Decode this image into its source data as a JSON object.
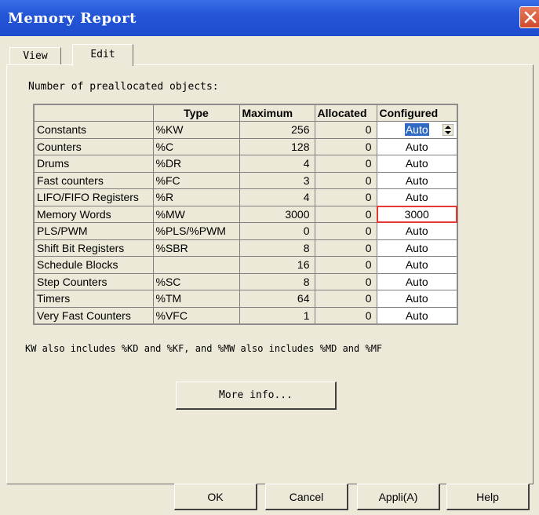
{
  "window": {
    "title": "Memory Report"
  },
  "tabs": [
    {
      "label": "View"
    },
    {
      "label": "Edit"
    }
  ],
  "section_label": "Number of preallocated objects:",
  "table": {
    "headers": [
      "",
      "Type",
      "Maximum",
      "Allocated",
      "Configured"
    ],
    "rows": [
      {
        "name": "Constants",
        "type": "%KW",
        "maximum": "256",
        "allocated": "0",
        "configured": "Auto"
      },
      {
        "name": "Counters",
        "type": "%C",
        "maximum": "128",
        "allocated": "0",
        "configured": "Auto"
      },
      {
        "name": "Drums",
        "type": "%DR",
        "maximum": "4",
        "allocated": "0",
        "configured": "Auto"
      },
      {
        "name": "Fast counters",
        "type": "%FC",
        "maximum": "3",
        "allocated": "0",
        "configured": "Auto"
      },
      {
        "name": "LIFO/FIFO Registers",
        "type": "%R",
        "maximum": "4",
        "allocated": "0",
        "configured": "Auto"
      },
      {
        "name": "Memory Words",
        "type": "%MW",
        "maximum": "3000",
        "allocated": "0",
        "configured": "3000"
      },
      {
        "name": "PLS/PWM",
        "type": "%PLS/%PWM",
        "maximum": "0",
        "allocated": "0",
        "configured": "Auto"
      },
      {
        "name": "Shift Bit Registers",
        "type": "%SBR",
        "maximum": "8",
        "allocated": "0",
        "configured": "Auto"
      },
      {
        "name": "Schedule Blocks",
        "type": "",
        "maximum": "16",
        "allocated": "0",
        "configured": "Auto"
      },
      {
        "name": "Step Counters",
        "type": "%SC",
        "maximum": "8",
        "allocated": "0",
        "configured": "Auto"
      },
      {
        "name": "Timers",
        "type": "%TM",
        "maximum": "64",
        "allocated": "0",
        "configured": "Auto"
      },
      {
        "name": "Very Fast Counters",
        "type": "%VFC",
        "maximum": "1",
        "allocated": "0",
        "configured": "Auto"
      }
    ]
  },
  "note": "KW also includes %KD and %KF, and %MW also includes  %MD and %MF",
  "buttons": {
    "more_info": "More info...",
    "ok": "OK",
    "cancel": "Cancel",
    "appli": "Appli(A)",
    "help": "Help"
  },
  "highlight_color": "#e53935",
  "selection_color": "#316ac5"
}
